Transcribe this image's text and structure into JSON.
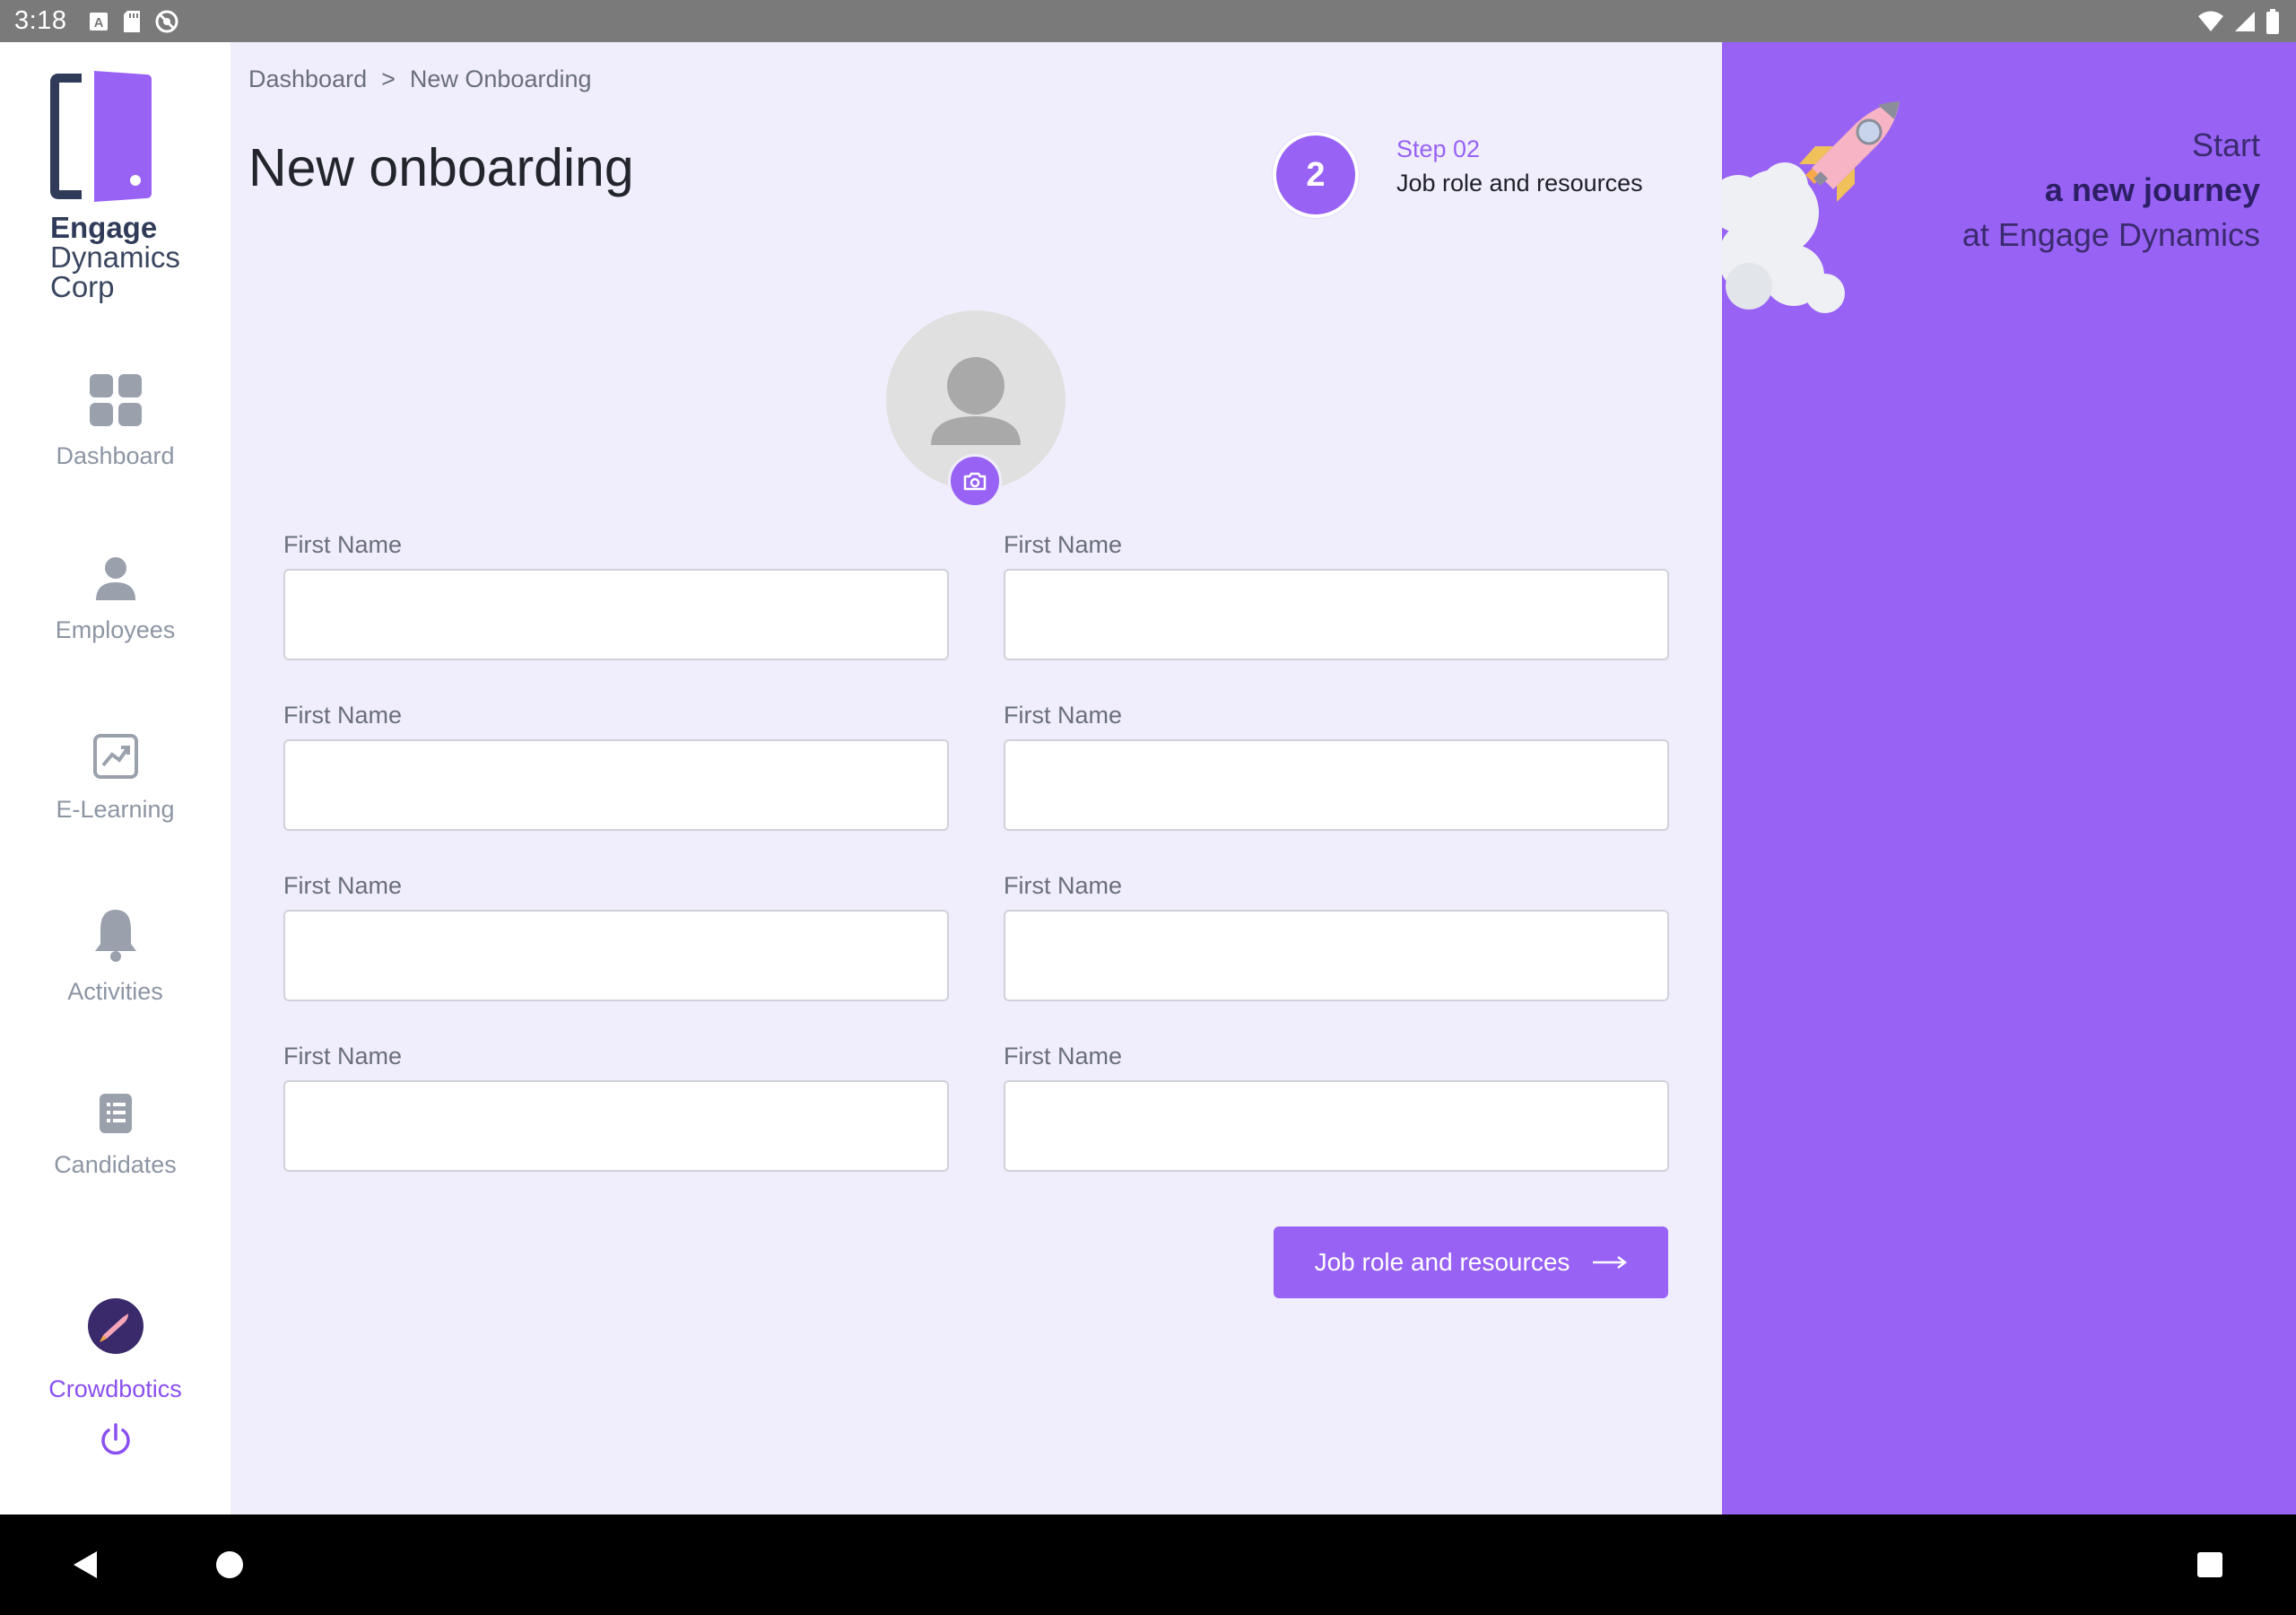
{
  "status_bar": {
    "time": "3:18"
  },
  "brand": {
    "line1": "Engage",
    "line2": "Dynamics",
    "line3": "Corp"
  },
  "sidebar": {
    "items": [
      {
        "label": "Dashboard",
        "icon": "dashboard-grid-icon"
      },
      {
        "label": "Employees",
        "icon": "person-icon"
      },
      {
        "label": "E-Learning",
        "icon": "chart-trend-icon"
      },
      {
        "label": "Activities",
        "icon": "bell-icon"
      },
      {
        "label": "Candidates",
        "icon": "document-list-icon"
      }
    ],
    "user": {
      "name": "Crowdbotics"
    }
  },
  "breadcrumb": {
    "root": "Dashboard",
    "separator": ">",
    "current": "New Onboarding"
  },
  "page": {
    "title": "New onboarding"
  },
  "stepper": {
    "number": "2",
    "step_label": "Step 02",
    "step_description": "Job role and resources"
  },
  "form": {
    "fields": [
      {
        "label": "First Name",
        "value": "",
        "placeholder": ""
      },
      {
        "label": "First Name",
        "value": "",
        "placeholder": ""
      },
      {
        "label": "First Name",
        "value": "",
        "placeholder": ""
      },
      {
        "label": "First Name",
        "value": "",
        "placeholder": ""
      },
      {
        "label": "First Name",
        "value": "",
        "placeholder": ""
      },
      {
        "label": "First Name",
        "value": "",
        "placeholder": ""
      },
      {
        "label": "First Name",
        "value": "",
        "placeholder": ""
      },
      {
        "label": "First Name",
        "value": "",
        "placeholder": ""
      }
    ],
    "next_button": {
      "label": "Job role and resources",
      "icon": "arrow-right-icon"
    }
  },
  "promo": {
    "line1": "Start",
    "line2": "a new journey",
    "line3": "at Engage Dynamics"
  },
  "colors": {
    "accent": "#9862f5",
    "background": "#f0eefc",
    "sidebar": "#ffffff",
    "icon_gray": "#8d95a3"
  }
}
